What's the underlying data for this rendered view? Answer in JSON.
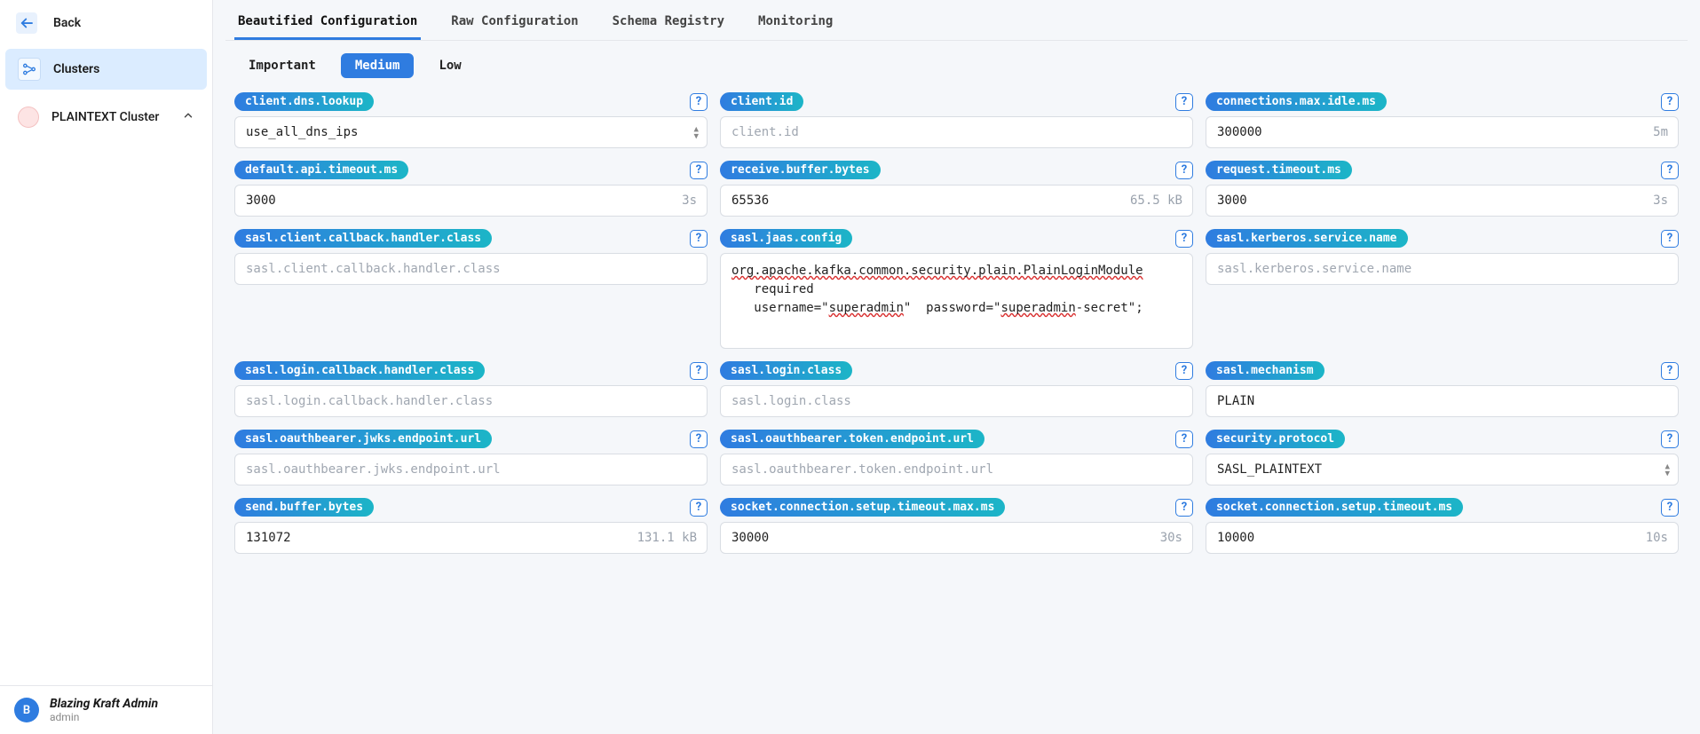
{
  "sidebar": {
    "back_label": "Back",
    "nav_clusters_label": "Clusters",
    "cluster_name": "PLAINTEXT Cluster",
    "user_initial": "B",
    "user_name": "Blazing Kraft Admin",
    "user_role": "admin"
  },
  "tabs": [
    {
      "label": "Beautified Configuration",
      "active": true
    },
    {
      "label": "Raw Configuration",
      "active": false
    },
    {
      "label": "Schema Registry",
      "active": false
    },
    {
      "label": "Monitoring",
      "active": false
    }
  ],
  "importance": [
    {
      "label": "Important",
      "selected": false
    },
    {
      "label": "Medium",
      "selected": true
    },
    {
      "label": "Low",
      "selected": false
    }
  ],
  "cfg": {
    "client_dns_lookup": {
      "key": "client.dns.lookup",
      "value": "use_all_dns_ips",
      "hint": "",
      "select": true
    },
    "client_id": {
      "key": "client.id",
      "value": "",
      "placeholder": "client.id",
      "hint": ""
    },
    "connections_max_idle_ms": {
      "key": "connections.max.idle.ms",
      "value": "300000",
      "hint": "5m"
    },
    "default_api_timeout_ms": {
      "key": "default.api.timeout.ms",
      "value": "3000",
      "hint": "3s"
    },
    "receive_buffer_bytes": {
      "key": "receive.buffer.bytes",
      "value": "65536",
      "hint": "65.5 kB"
    },
    "request_timeout_ms": {
      "key": "request.timeout.ms",
      "value": "3000",
      "hint": "3s"
    },
    "sasl_client_callback_handler_class": {
      "key": "sasl.client.callback.handler.class",
      "value": "",
      "placeholder": "sasl.client.callback.handler.class",
      "hint": ""
    },
    "sasl_jaas_config": {
      "key": "sasl.jaas.config",
      "value_html": "<span class=\"spell-err\">org.apache.kafka.common.security.plain.PlainLoginModule</span>\n   required\n   username=\"<span class=\"spell-err\">superadmin</span>\"  password=\"<span class=\"spell-err\">superadmin</span>-secret\";"
    },
    "sasl_kerberos_service_name": {
      "key": "sasl.kerberos.service.name",
      "value": "",
      "placeholder": "sasl.kerberos.service.name",
      "hint": ""
    },
    "sasl_login_callback_handler_class": {
      "key": "sasl.login.callback.handler.class",
      "value": "",
      "placeholder": "sasl.login.callback.handler.class",
      "hint": ""
    },
    "sasl_login_class": {
      "key": "sasl.login.class",
      "value": "",
      "placeholder": "sasl.login.class",
      "hint": ""
    },
    "sasl_mechanism": {
      "key": "sasl.mechanism",
      "value": "PLAIN",
      "hint": ""
    },
    "sasl_oauthbearer_jwks_endpoint_url": {
      "key": "sasl.oauthbearer.jwks.endpoint.url",
      "value": "",
      "placeholder": "sasl.oauthbearer.jwks.endpoint.url",
      "hint": ""
    },
    "sasl_oauthbearer_token_endpoint_url": {
      "key": "sasl.oauthbearer.token.endpoint.url",
      "value": "",
      "placeholder": "sasl.oauthbearer.token.endpoint.url",
      "hint": ""
    },
    "security_protocol": {
      "key": "security.protocol",
      "value": "SASL_PLAINTEXT",
      "hint": "",
      "select": true
    },
    "send_buffer_bytes": {
      "key": "send.buffer.bytes",
      "value": "131072",
      "hint": "131.1 kB"
    },
    "socket_connection_setup_timeout_max_ms": {
      "key": "socket.connection.setup.timeout.max.ms",
      "value": "30000",
      "hint": "30s"
    },
    "socket_connection_setup_timeout_ms": {
      "key": "socket.connection.setup.timeout.ms",
      "value": "10000",
      "hint": "10s"
    }
  }
}
